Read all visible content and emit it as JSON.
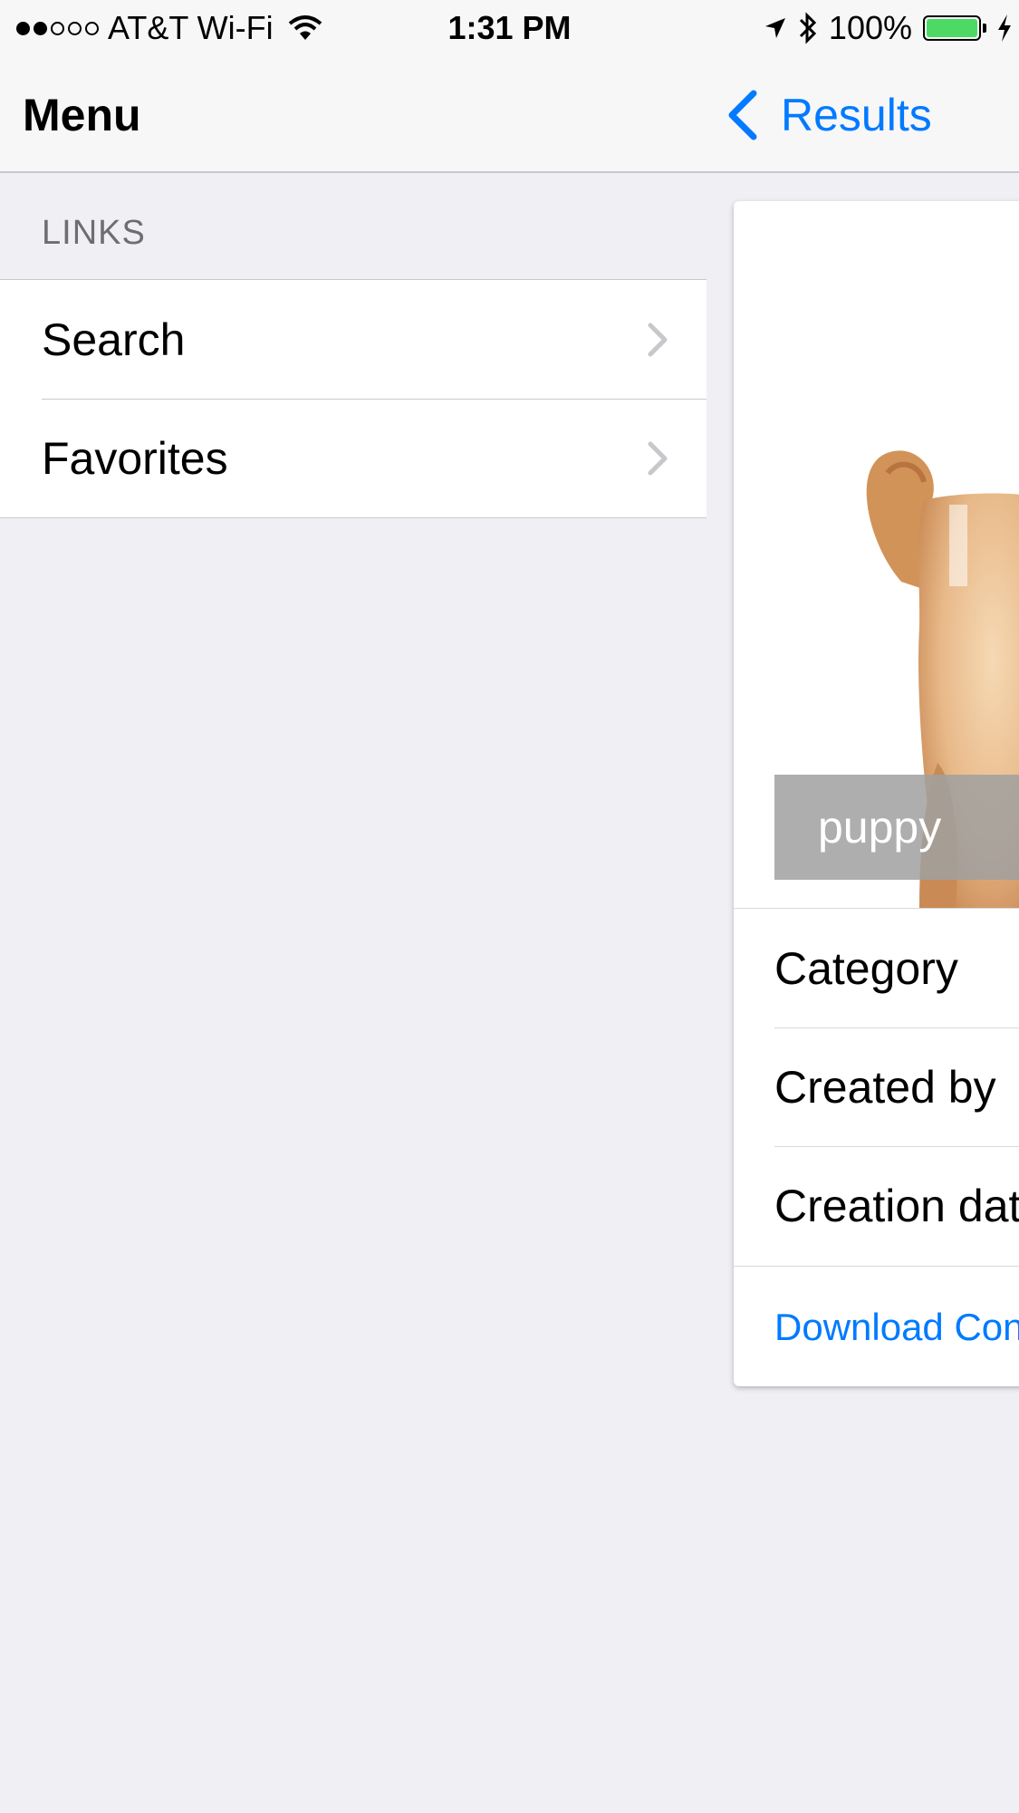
{
  "status_bar": {
    "carrier": "AT&T Wi-Fi",
    "time": "1:31 PM",
    "battery": "100%",
    "signal_bars_filled": 2,
    "signal_bars_total": 5
  },
  "nav": {
    "title": "Menu",
    "back_label": "Results"
  },
  "menu": {
    "section_header": "LINKS",
    "items": [
      {
        "label": "Search"
      },
      {
        "label": "Favorites"
      }
    ]
  },
  "detail": {
    "image_tag": "puppy",
    "rows": [
      {
        "label": "Category"
      },
      {
        "label": "Created by"
      },
      {
        "label": "Creation dat"
      }
    ],
    "download_label": "Download Con"
  },
  "colors": {
    "accent": "#007aff",
    "background": "#efeff4",
    "battery_fill": "#4cd964"
  },
  "icons": [
    "wifi-icon",
    "location-arrow-icon",
    "bluetooth-icon",
    "battery-icon",
    "charging-icon",
    "chevron-left-icon",
    "chevron-right-icon"
  ]
}
